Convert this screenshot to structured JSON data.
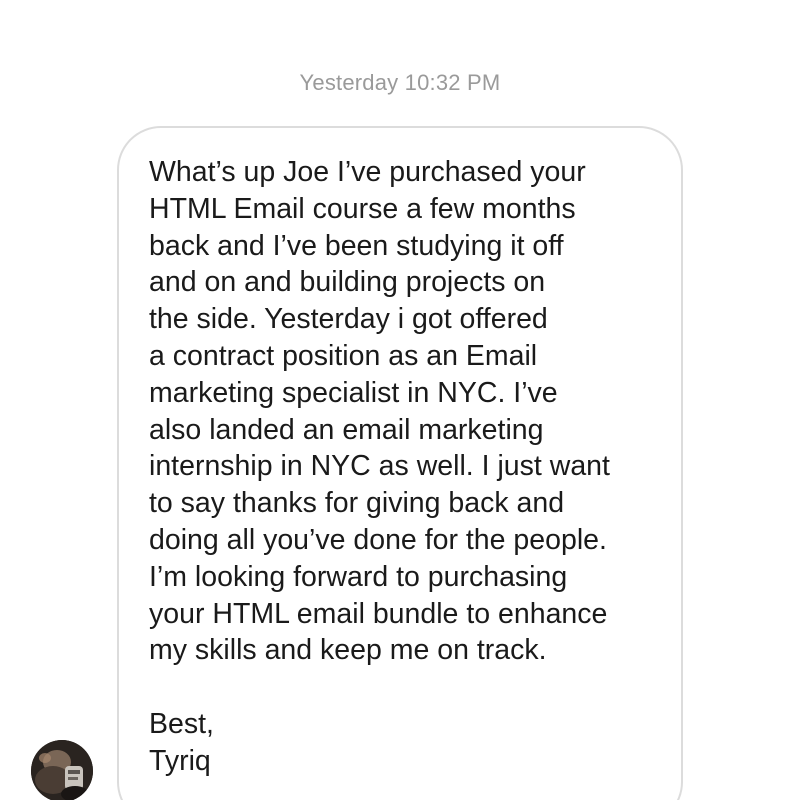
{
  "thread": {
    "timestamp": "Yesterday 10:32 PM"
  },
  "message": {
    "lines": [
      "What’s up Joe I’ve purchased your",
      "HTML Email course a few months",
      "back and I’ve been studying it off",
      "and on and building projects on",
      "the side. Yesterday i got offered",
      "a contract position as an Email",
      "marketing specialist in NYC. I’ve",
      "also landed an email marketing",
      "internship in NYC as well. I just want",
      "to say thanks for giving back and",
      "doing all you’ve done for the people.",
      "I’m looking forward to purchasing",
      "your HTML email bundle to enhance",
      "my skills and keep me on track."
    ],
    "signoff": "Best,",
    "signature": "Tyriq"
  },
  "sender": {
    "avatar": "user-photo"
  }
}
